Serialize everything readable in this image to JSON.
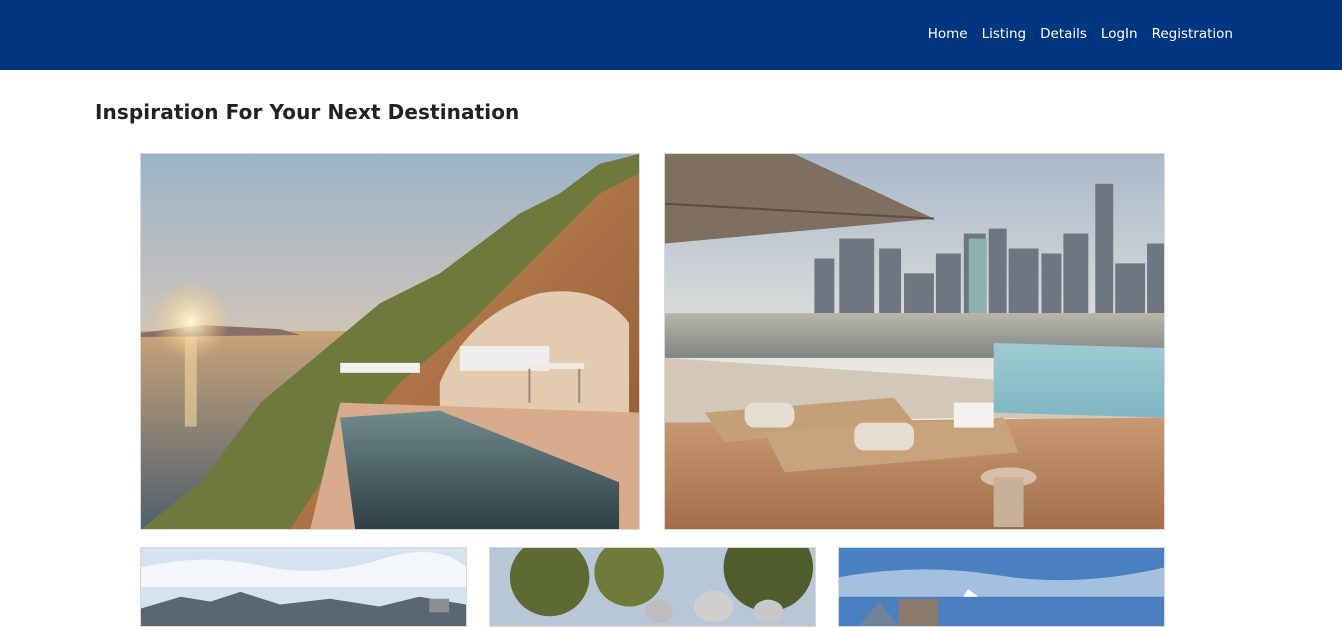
{
  "navbar": {
    "background": "#003580",
    "links": [
      {
        "label": "Home"
      },
      {
        "label": "Listing"
      },
      {
        "label": "Details"
      },
      {
        "label": "LogIn"
      },
      {
        "label": "Registration"
      }
    ]
  },
  "main": {
    "heading": "Inspiration For Your Next Destination",
    "destinations": [
      {
        "image": "cliffside-cave-pool-sunset"
      },
      {
        "image": "rooftop-pool-city-skyline"
      },
      {
        "image": "mountain-town-sky"
      },
      {
        "image": "trees-and-stone-sculptures"
      },
      {
        "image": "glass-pyramid-blue-sky"
      }
    ]
  }
}
